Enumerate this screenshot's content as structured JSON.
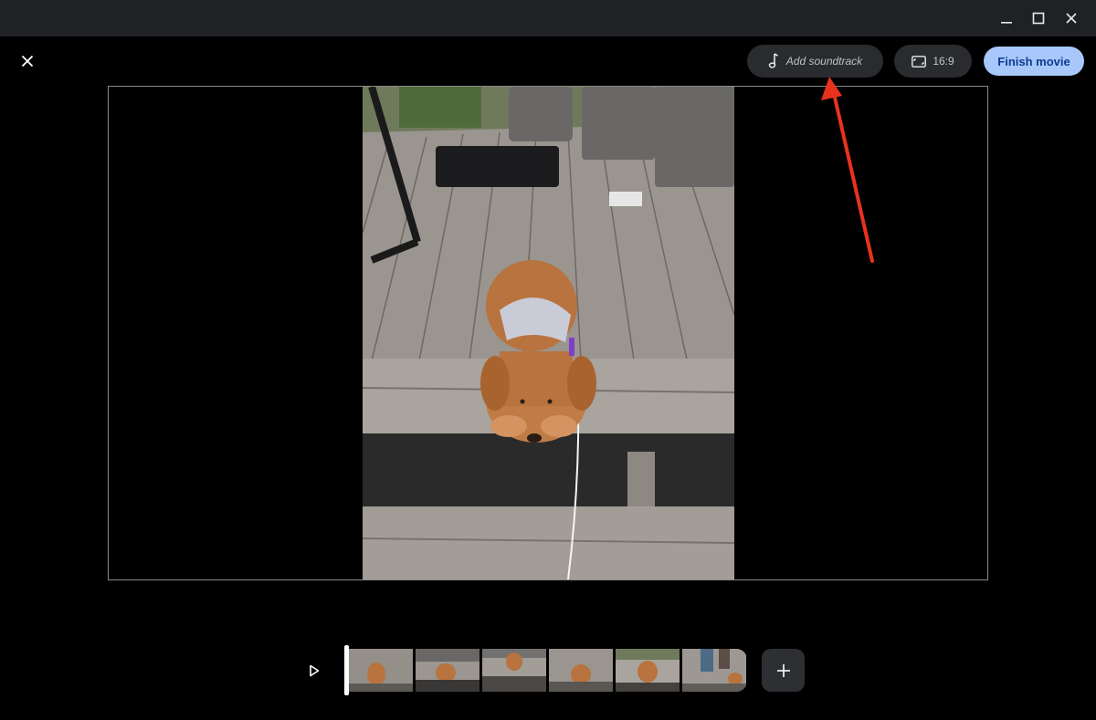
{
  "window": {
    "minimize_icon": "minimize-icon",
    "maximize_icon": "maximize-icon",
    "close_icon": "close-icon"
  },
  "toolbar": {
    "close_icon": "close-icon",
    "soundtrack": {
      "icon": "music-note-icon",
      "label": "Add soundtrack"
    },
    "aspect": {
      "icon": "aspect-ratio-icon",
      "label": "16:9"
    },
    "finish_label": "Finish movie"
  },
  "timeline": {
    "play_icon": "play-icon",
    "add_icon": "plus-icon",
    "thumbnail_count": 6
  },
  "colors": {
    "accent": "#a8c7fa",
    "annotation_arrow": "#e8321e"
  }
}
